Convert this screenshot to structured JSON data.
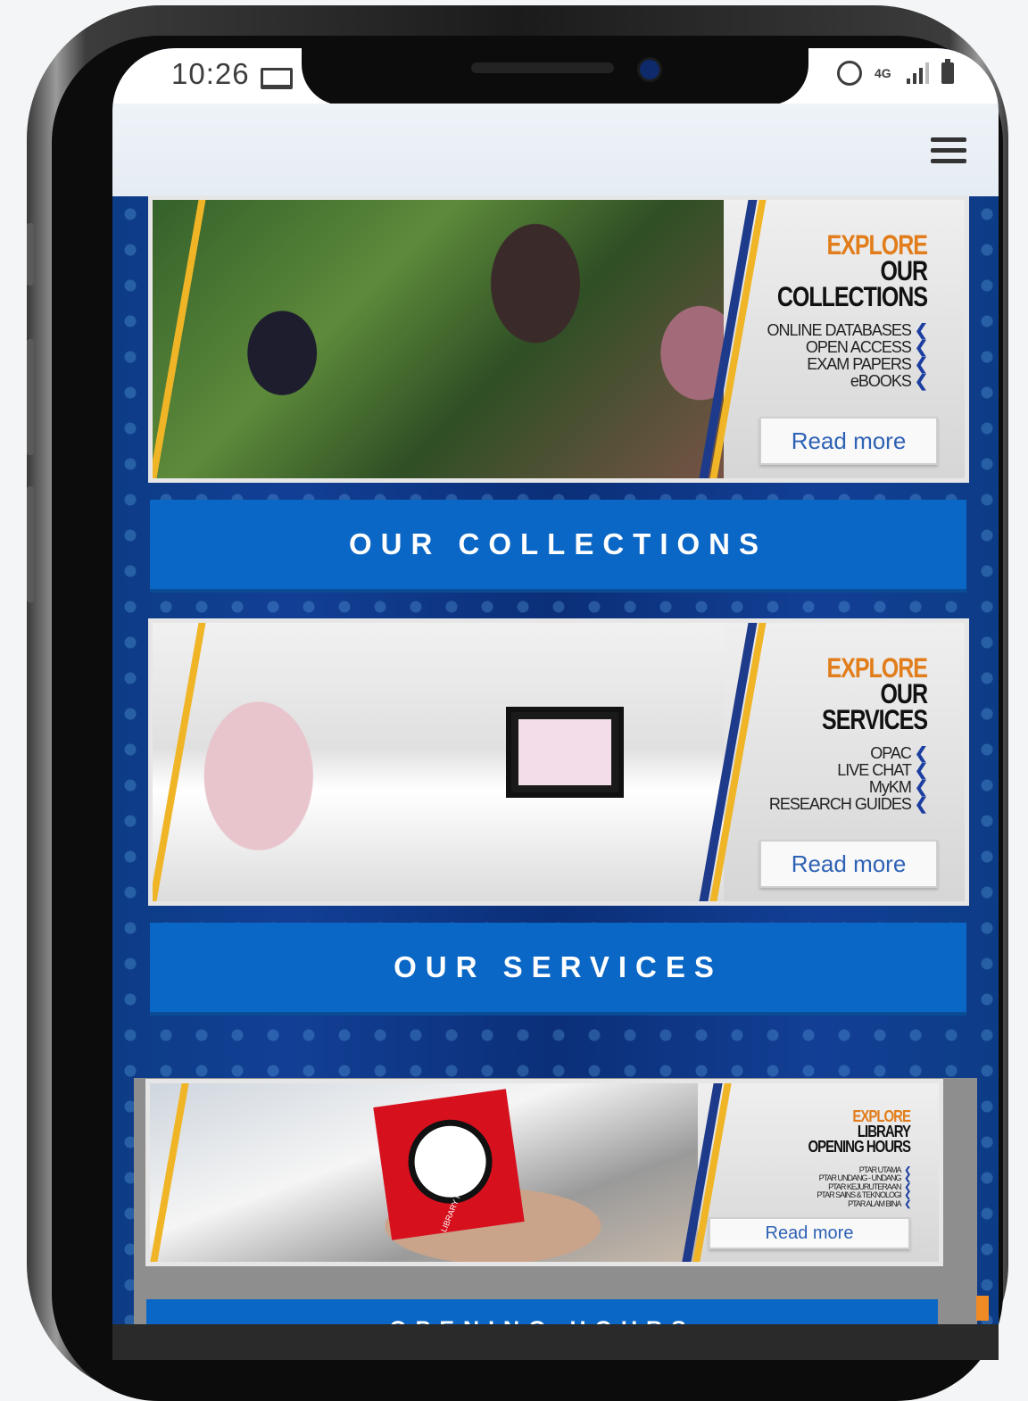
{
  "status_bar": {
    "time": "10:26",
    "network": "4G",
    "icons": [
      "laptop-icon",
      "alarm-icon",
      "network-4g-icon",
      "signal-icon",
      "battery-icon"
    ]
  },
  "header": {
    "menu_icon": "hamburger-menu-icon"
  },
  "banners": [
    {
      "line1": "EXPLORE",
      "line2": "OUR",
      "line3": "COLLECTIONS",
      "items": [
        "ONLINE DATABASES",
        "OPEN ACCESS",
        "EXAM PAPERS",
        "eBOOKS"
      ],
      "read_more": "Read more",
      "button": "OUR COLLECTIONS"
    },
    {
      "line1": "EXPLORE",
      "line2": "OUR",
      "line3": "SERVICES",
      "items": [
        "OPAC",
        "LIVE CHAT",
        "MyKM",
        "RESEARCH GUIDES"
      ],
      "read_more": "Read more",
      "button": "OUR SERVICES"
    },
    {
      "line1": "EXPLORE",
      "line2": "LIBRARY",
      "line3": "OPENING HOURS",
      "items": [
        "PTAR UTAMA",
        "PTAR UNDANG - UNDANG",
        "PTAR KEJURUTERAAN",
        "PTAR SAINS & TEKNOLOGI",
        "PTAR ALAM BINA"
      ],
      "photo_label": "LIBRARY HOURS",
      "read_more": "Read more",
      "button": "OPENING HOURS"
    }
  ],
  "colors": {
    "accent_blue": "#0b67c5",
    "explore_orange": "#e27d1b",
    "link_blue": "#2e62b5",
    "background_navy": "#123f8f"
  }
}
